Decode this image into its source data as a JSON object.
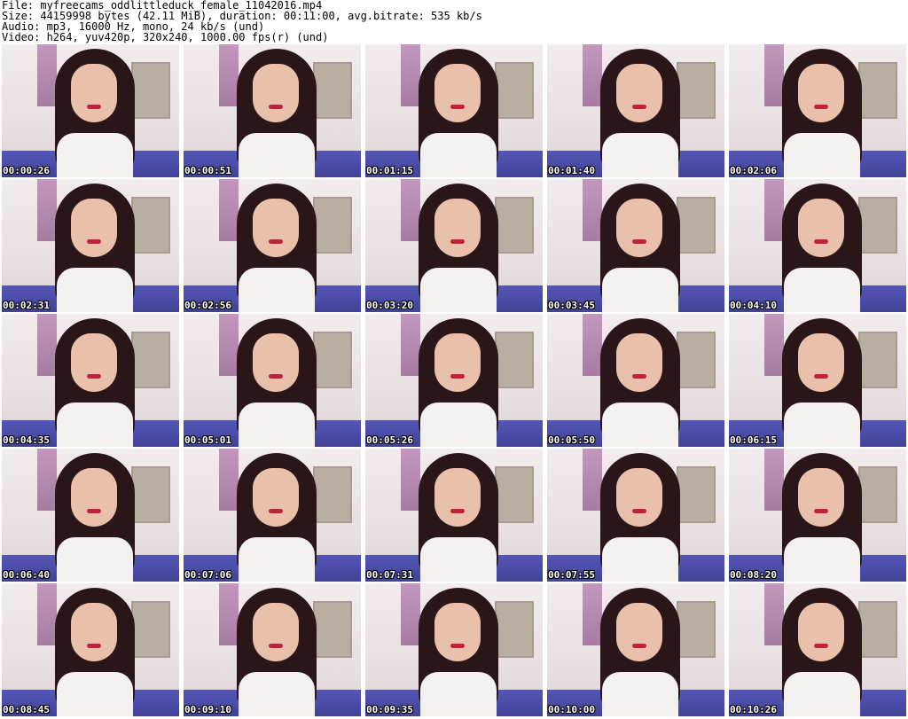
{
  "header": {
    "file_line": "File: myfreecams_oddlittleduck_female_11042016.mp4",
    "size_line": "Size: 44159998 bytes (42.11 MiB), duration: 00:11:00, avg.bitrate: 535 kb/s",
    "audio_line": "Audio: mp3, 16000 Hz, mono, 24 kb/s (und)",
    "video_line": "Video: h264, yuv420p, 320x240, 1000.00 fps(r) (und)"
  },
  "thumbnails": [
    {
      "timestamp": "00:00:26"
    },
    {
      "timestamp": "00:00:51"
    },
    {
      "timestamp": "00:01:15"
    },
    {
      "timestamp": "00:01:40"
    },
    {
      "timestamp": "00:02:06"
    },
    {
      "timestamp": "00:02:31"
    },
    {
      "timestamp": "00:02:56"
    },
    {
      "timestamp": "00:03:20"
    },
    {
      "timestamp": "00:03:45"
    },
    {
      "timestamp": "00:04:10"
    },
    {
      "timestamp": "00:04:35"
    },
    {
      "timestamp": "00:05:01"
    },
    {
      "timestamp": "00:05:26"
    },
    {
      "timestamp": "00:05:50"
    },
    {
      "timestamp": "00:06:15"
    },
    {
      "timestamp": "00:06:40"
    },
    {
      "timestamp": "00:07:06"
    },
    {
      "timestamp": "00:07:31"
    },
    {
      "timestamp": "00:07:55"
    },
    {
      "timestamp": "00:08:20"
    },
    {
      "timestamp": "00:08:45"
    },
    {
      "timestamp": "00:09:10"
    },
    {
      "timestamp": "00:09:35"
    },
    {
      "timestamp": "00:10:00"
    },
    {
      "timestamp": "00:10:26"
    }
  ]
}
